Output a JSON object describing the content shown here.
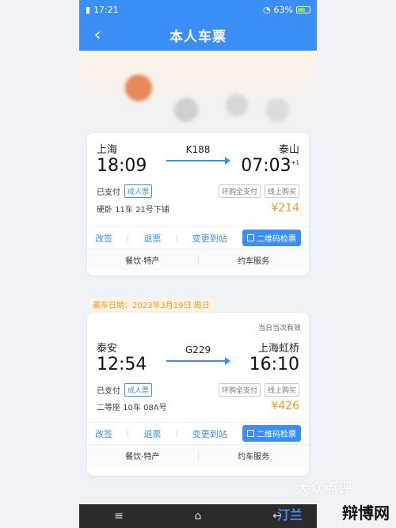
{
  "status": {
    "time": "17:21",
    "battery": "63%",
    "battery_level": 0.63
  },
  "header": {
    "title": "本人车票"
  },
  "tickets": [
    {
      "from": "上海",
      "to": "泰山",
      "train": "K188",
      "depart": "18:09",
      "arrive": "07:03",
      "day_offset": "+1",
      "paid": "已支付",
      "passenger_tag": "成人票",
      "tags": [
        "环购全支付",
        "线上购买"
      ],
      "seat": "硬卧 11车 21号下铺",
      "price": "¥214",
      "actions": [
        "改签",
        "退票",
        "变更到站",
        "二维码检票"
      ],
      "services": [
        "餐饮·特产",
        "约车服务"
      ]
    },
    {
      "from": "泰安",
      "to": "上海虹桥",
      "train": "G229",
      "depart": "12:54",
      "arrive": "16:10",
      "paid": "已支付",
      "passenger_tag": "成人票",
      "tags": [
        "环购全支付",
        "线上购买"
      ],
      "seat": "二等座 10车 08A号",
      "price": "¥426",
      "valid_note": "当日当次有效",
      "date_label": "乘车日期：2023年3月19日 周日",
      "actions": [
        "改签",
        "退票",
        "变更到站",
        "二维码检票"
      ],
      "services": [
        "餐饮·特产",
        "约车服务"
      ]
    }
  ],
  "watermark": {
    "text": "大众点评",
    "logo_left": "汀兰",
    "logo_right": "辩博网"
  },
  "colors": {
    "accent": "#3b8ef3",
    "price": "#f39a1e"
  }
}
